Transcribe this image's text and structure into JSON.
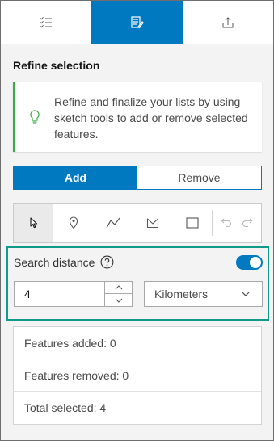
{
  "tabs": [
    {
      "icon": "list-check-icon"
    },
    {
      "icon": "edit-form-icon",
      "active": true
    },
    {
      "icon": "export-icon"
    }
  ],
  "refine": {
    "title": "Refine selection",
    "notice": "Refine and finalize your lists by using sketch tools to add or remove selected features."
  },
  "mode": {
    "add": "Add",
    "remove": "Remove",
    "selected": "Add"
  },
  "sketch_tools": [
    "select-pointer-icon",
    "point-icon",
    "polyline-icon",
    "polygon-icon",
    "rectangle-icon",
    "undo-icon",
    "redo-icon"
  ],
  "search": {
    "label": "Search distance",
    "enabled": true,
    "distance": "4",
    "unit": "Kilometers"
  },
  "stats": {
    "added": "Features added: 0",
    "removed": "Features removed: 0",
    "total": "Total selected: 4"
  },
  "colors": {
    "accent": "#0079c1",
    "success": "#35ac46",
    "focus": "#0f9a8a"
  }
}
